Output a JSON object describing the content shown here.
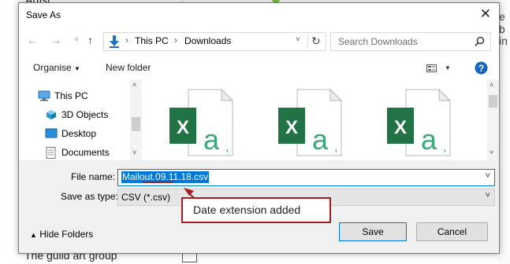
{
  "background": {
    "top_text": "Artist",
    "bottom_text": "The guild art group",
    "right_text_1": "e b",
    "right_text_2": "in"
  },
  "dialog": {
    "title": "Save As",
    "close_icon": "close-icon"
  },
  "nav": {
    "back_icon": "back-arrow-icon",
    "forward_icon": "forward-arrow-icon",
    "recent_icon": "chevron-down-icon",
    "up_icon": "up-arrow-icon",
    "path": [
      "This PC",
      "Downloads"
    ],
    "refresh_icon": "refresh-icon",
    "search_placeholder": "Search Downloads",
    "search_icon": "search-icon"
  },
  "toolbar": {
    "organise_label": "Organise",
    "new_folder_label": "New folder",
    "view_icon": "view-options-icon",
    "help_icon": "help-icon"
  },
  "tree": {
    "items": [
      {
        "label": "This PC",
        "icon": "computer-icon"
      },
      {
        "label": "3D Objects",
        "icon": "3d-objects-icon"
      },
      {
        "label": "Desktop",
        "icon": "desktop-icon"
      },
      {
        "label": "Documents",
        "icon": "documents-icon"
      }
    ]
  },
  "files": {
    "icon": "excel-csv-file-icon",
    "count": 3
  },
  "form": {
    "file_name_label": "File name:",
    "file_name_value": "Mailout.09.11.18.csv",
    "save_type_label": "Save as type:",
    "save_type_value": "CSV (*.csv)"
  },
  "annotation": {
    "text": "Date extension added",
    "color": "#a61c1c"
  },
  "footer": {
    "hide_folders_label": "Hide Folders",
    "save_label": "Save",
    "cancel_label": "Cancel"
  },
  "colors": {
    "accent": "#0078d7",
    "excel_green": "#217346",
    "callout_red": "#a61c1c"
  }
}
